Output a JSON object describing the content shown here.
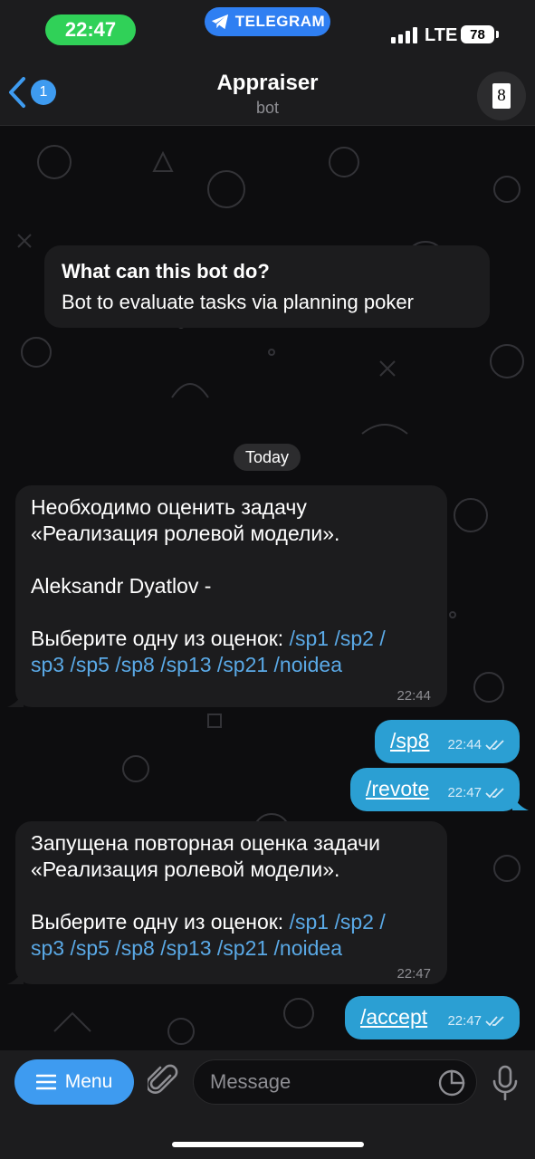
{
  "status_bar": {
    "time": "22:47",
    "app_pill": "TELEGRAM",
    "network": "LTE",
    "battery": "78"
  },
  "header": {
    "back_count": "1",
    "title": "Appraiser",
    "subtitle": "bot",
    "avatar_card": "8"
  },
  "intro": {
    "title": "What can this bot do?",
    "text": "Bot to evaluate tasks via planning poker"
  },
  "date_separator": "Today",
  "messages": {
    "m1": {
      "l1": "Необходимо оценить задачу",
      "l2": "«Реализация ролевой модели».",
      "l3": "Aleksandr Dyatlov -",
      "l4": "Выберите одну из оценок: ",
      "c1": "/sp1",
      "c2": "/sp2",
      "slash": "/",
      "c3": "sp3",
      "c4": "/sp5",
      "c5": "/sp8",
      "c6": "/sp13",
      "c7": "/sp21",
      "c8": "/noidea",
      "time": "22:44"
    },
    "m2": {
      "text": "/sp8",
      "time": "22:44"
    },
    "m3": {
      "text": "/revote",
      "time": "22:47"
    },
    "m4": {
      "l1": "Запущена повторная оценка задачи",
      "l2": "«Реализация ролевой модели».",
      "l3": "Выберите одну из оценок: ",
      "c1": "/sp1",
      "c2": "/sp2",
      "slash": "/",
      "c3": "sp3",
      "c4": "/sp5",
      "c5": "/sp8",
      "c6": "/sp13",
      "c7": "/sp21",
      "c8": "/noidea",
      "time": "22:47"
    },
    "m5": {
      "text": "/accept",
      "time": "22:47"
    }
  },
  "composer": {
    "menu_label": "Menu",
    "placeholder": "Message"
  },
  "colors": {
    "accent": "#3e9bf0",
    "outgoing": "#2b9fd3",
    "link": "#5aa9e6",
    "status_green": "#30d158"
  }
}
